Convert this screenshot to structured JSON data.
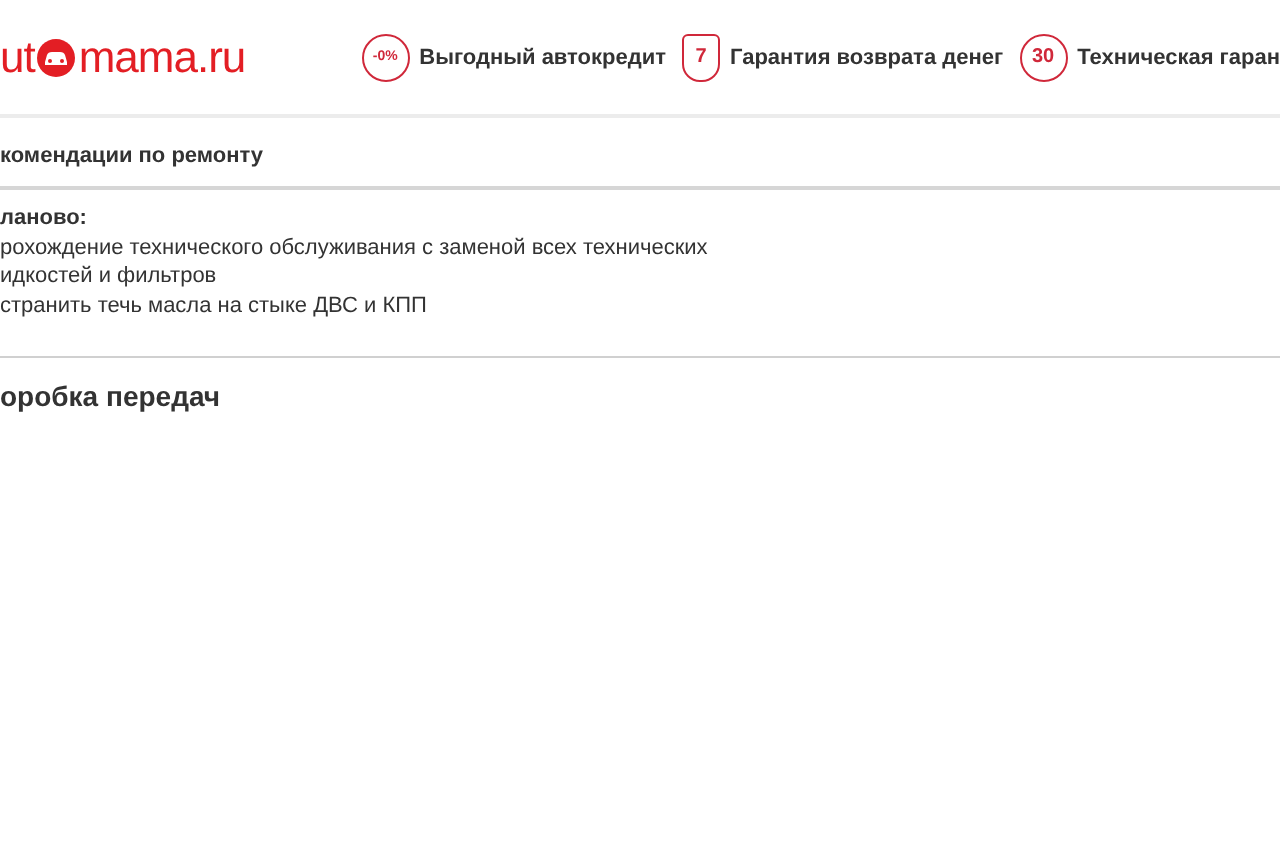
{
  "logo": {
    "before": "ut",
    "after": "mama.ru"
  },
  "benefits": [
    {
      "kind": "credit",
      "badge": "-0%",
      "label": "Выгодный автокредит"
    },
    {
      "kind": "refund",
      "badge": "7",
      "label": "Гарантия возврата денег"
    },
    {
      "kind": "warranty",
      "badge": "30",
      "label": "Техническая гаран"
    }
  ],
  "recommendations": {
    "title": "комендации по ремонту",
    "subtitle": "ланово:",
    "lines": [
      "рохождение технического обслуживания с заменой всех технических",
      "идкостей и фильтров",
      "странить течь масла на стыке ДВС и КПП"
    ]
  },
  "section_heading": "оробка передач"
}
